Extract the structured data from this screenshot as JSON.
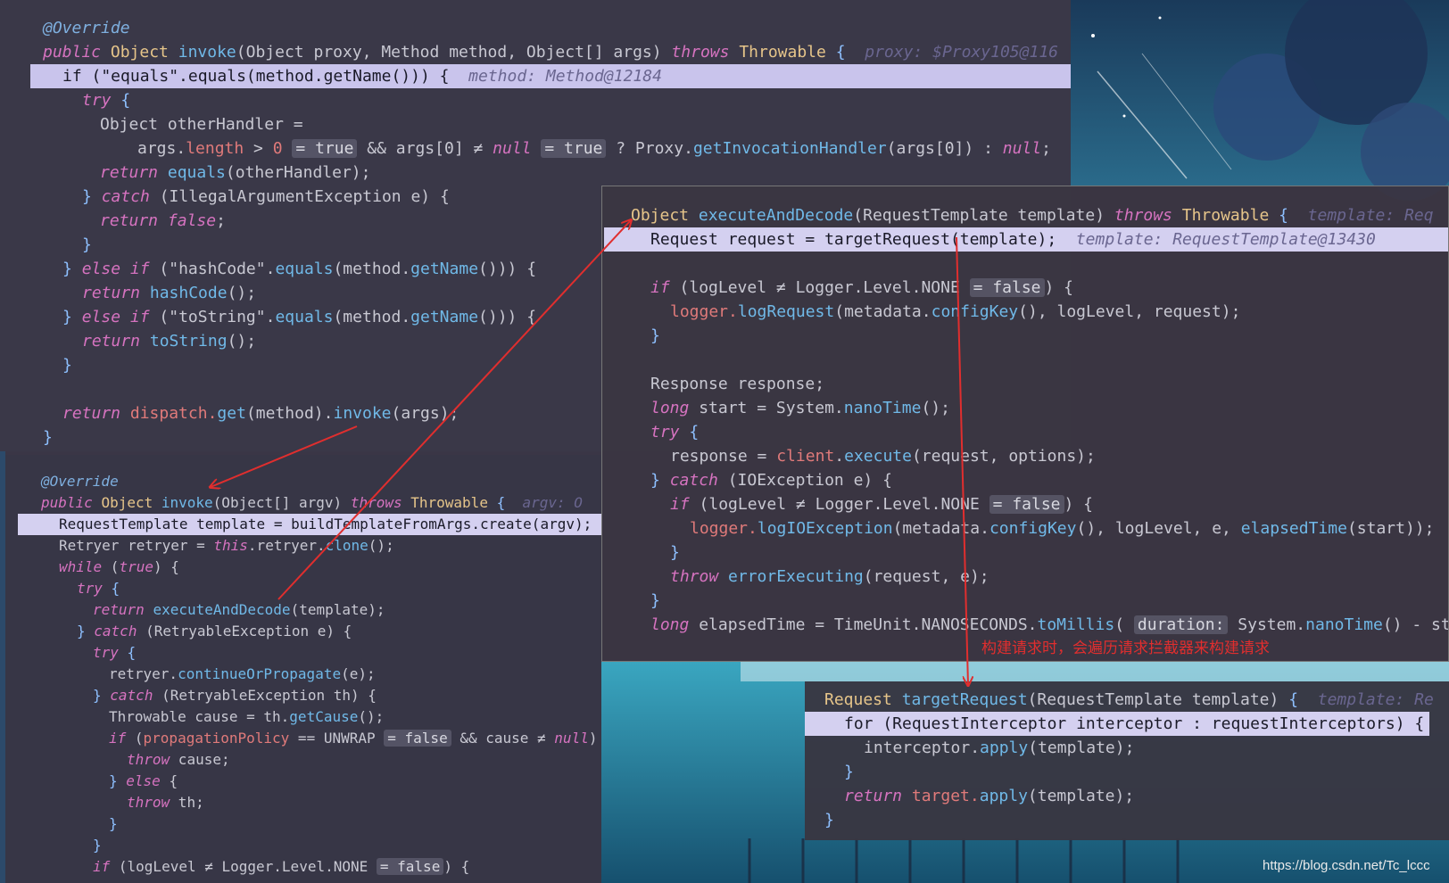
{
  "colors": {
    "keyword": "#d673c0",
    "function": "#70b9e8",
    "type": "#e6c58a",
    "number": "#e07a7a",
    "highlight": "#c9c4ec",
    "arrow": "#e02e2e"
  },
  "panel1": {
    "annotation": "@Override",
    "signature": {
      "mod": "public",
      "ret": "Object",
      "name": "invoke",
      "params": "(Object proxy, Method method, Object[] args)",
      "throws": "throws",
      "exc": "Throwable",
      "hint": "proxy: $Proxy105@116"
    },
    "hl": {
      "code": "if (\"equals\".equals(method.getName())) {",
      "hint": "method: Method@12184"
    },
    "try": "try",
    "line_other": "Object otherHandler =",
    "line_args": {
      "a": "args.",
      "b": "length",
      "c": " > ",
      "d": "0",
      "e": "= true",
      "f": " && args[0] ≠ ",
      "g": "null",
      "h": "= true",
      "i": " ? Proxy.",
      "j": "getInvocationHandler",
      "k": "(args[0]) : ",
      "l": "null",
      "m": ";"
    },
    "ret_equals": {
      "k": "return",
      "f": "equals",
      "r": "(otherHandler);"
    },
    "catch_line": {
      "k": "catch",
      "r": " (IllegalArgumentException e) {"
    },
    "ret_false": {
      "k": "return",
      "v": "false",
      "r": ";"
    },
    "elif1": {
      "k": "else if",
      "s": "(\"hashCode\".",
      "f": "equals",
      "r": "(method.",
      "g": "getName",
      "e": "())) {"
    },
    "ret_hash": {
      "k": "return",
      "f": "hashCode",
      "r": "();"
    },
    "elif2": {
      "k": "else if",
      "s": "(\"toString\".",
      "f": "equals",
      "r": "(method.",
      "g": "getName",
      "e": "())) {"
    },
    "ret_tostr": {
      "k": "return",
      "f": "toString",
      "r": "();"
    },
    "ret_dispatch": {
      "k": "return",
      "a": "dispatch.",
      "f": "get",
      "b": "(method).",
      "g": "invoke",
      "c": "(args);"
    }
  },
  "panel2": {
    "annotation": "@Override",
    "signature": {
      "mod": "public",
      "ret": "Object",
      "name": "invoke",
      "params": "(Object[] argv)",
      "throws": "throws",
      "exc": "Throwable",
      "hint": "argv: O"
    },
    "hl": "RequestTemplate template = buildTemplateFromArgs.create(argv);",
    "retryer": {
      "a": "Retryer retryer = ",
      "k": "this",
      "b": ".retryer.",
      "f": "clone",
      "c": "();"
    },
    "while": {
      "k": "while",
      "a": " (",
      "v": "true",
      "b": ") {"
    },
    "try": "try",
    "ret_exec": {
      "k": "return",
      "f": "executeAndDecode",
      "r": "(template);"
    },
    "catch1": {
      "k": "catch",
      "r": " (RetryableException e) {"
    },
    "try2": "try",
    "cont": {
      "a": "retryer.",
      "f": "continueOrPropagate",
      "r": "(e);"
    },
    "catch2": {
      "k": "catch",
      "r": " (RetryableException th) {"
    },
    "cause": {
      "a": "Throwable cause = th.",
      "f": "getCause",
      "r": "();"
    },
    "ifprop": {
      "k": "if",
      "a": " (",
      "p": "propagationPolicy",
      "b": " == UNWRAP",
      "i": "= false",
      "c": " && cause ≠ ",
      "n": "null",
      "d": ") {"
    },
    "throw1": {
      "k": "throw",
      "r": " cause;"
    },
    "else": {
      "k": "else",
      "r": " {"
    },
    "throw2": {
      "k": "throw",
      "r": " th;"
    },
    "iflog": {
      "k": "if",
      "a": " (logLevel ≠ Logger.Level.NONE",
      "i": "= false",
      "b": ") {"
    }
  },
  "panel3": {
    "signature": {
      "ret": "Object",
      "name": "executeAndDecode",
      "params": "(RequestTemplate template)",
      "throws": "throws",
      "exc": "Throwable",
      "hint": "template: Req"
    },
    "hl": {
      "code": "Request request = targetRequest(template);",
      "hint": "template: RequestTemplate@13430"
    },
    "if1": {
      "k": "if",
      "a": " (logLevel ≠ Logger.Level.NONE",
      "i": "= false",
      "b": ") {"
    },
    "logreq": {
      "a": "logger.",
      "f": "logRequest",
      "b": "(metadata.",
      "g": "configKey",
      "c": "(), logLevel, request);"
    },
    "resp": "Response response;",
    "long1": {
      "k": "long",
      "a": " start = System.",
      "f": "nanoTime",
      "r": "();"
    },
    "try": "try",
    "exec": {
      "a": "response = ",
      "c": "client",
      "b": ".",
      "f": "execute",
      "r": "(request, options);"
    },
    "catch": {
      "k": "catch",
      "r": " (IOException e) {"
    },
    "if2": {
      "k": "if",
      "a": " (logLevel ≠ Logger.Level.NONE",
      "i": "= false",
      "b": ") {"
    },
    "logio": {
      "a": "logger.",
      "f": "logIOException",
      "b": "(metadata.",
      "g": "configKey",
      "c": "(), logLevel, e, ",
      "h": "elapsedTime",
      "d": "(start));"
    },
    "throw": {
      "k": "throw",
      "f": "errorExecuting",
      "r": "(request, e);"
    },
    "long2": {
      "k": "long",
      "a": " elapsedTime = TimeUnit.NANOSECONDS.",
      "f": "toMillis",
      "b": "( ",
      "i": "duration:",
      "c": " System.",
      "g": "nanoTime",
      "d": "() - sta"
    }
  },
  "annotation_text": "构建请求时，会遍历请求拦截器来构建请求",
  "panel4": {
    "signature": {
      "ret": "Request",
      "name": "targetRequest",
      "params": "(RequestTemplate template)",
      "hint": "template: Re"
    },
    "hl": "for (RequestInterceptor interceptor : requestInterceptors) {",
    "apply": {
      "a": "interceptor.",
      "f": "apply",
      "r": "(template);"
    },
    "ret": {
      "k": "return",
      "a": " target.",
      "f": "apply",
      "r": "(template);"
    }
  },
  "watermark": "https://blog.csdn.net/Tc_lccc"
}
